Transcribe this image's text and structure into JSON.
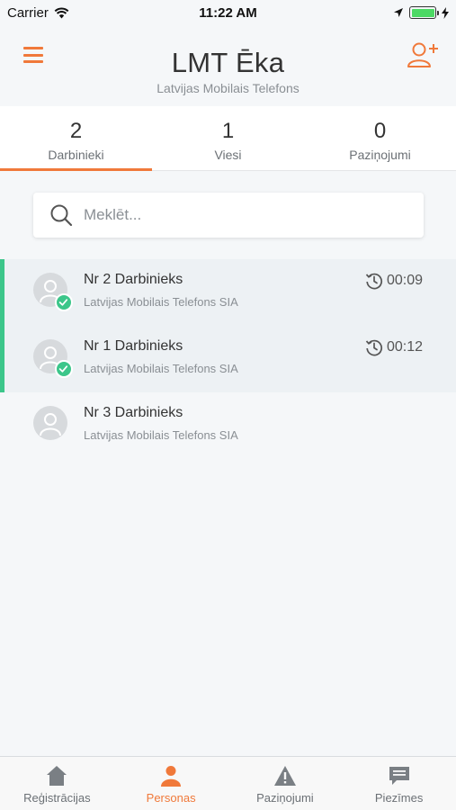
{
  "status_bar": {
    "carrier": "Carrier",
    "time": "11:22 AM",
    "battery_level": 1.0
  },
  "header": {
    "title": "LMT Ēka",
    "subtitle": "Latvijas Mobilais Telefons",
    "accent": "#f0793a"
  },
  "tabs": [
    {
      "count": "2",
      "label": "Darbinieki",
      "active": true
    },
    {
      "count": "1",
      "label": "Viesi",
      "active": false
    },
    {
      "count": "0",
      "label": "Paziņojumi",
      "active": false
    }
  ],
  "search": {
    "placeholder": "Meklēt...",
    "value": ""
  },
  "people": [
    {
      "name": "Nr 2 Darbinieks",
      "company": "Latvijas Mobilais Telefons SIA",
      "time": "00:09",
      "checked_in": true
    },
    {
      "name": "Nr 1 Darbinieks",
      "company": "Latvijas Mobilais Telefons SIA",
      "time": "00:12",
      "checked_in": true
    },
    {
      "name": "Nr 3 Darbinieks",
      "company": "Latvijas Mobilais Telefons SIA",
      "time": "",
      "checked_in": false
    }
  ],
  "bottom_nav": [
    {
      "label": "Reģistrācijas",
      "icon": "home-icon",
      "active": false
    },
    {
      "label": "Personas",
      "icon": "person-icon",
      "active": true
    },
    {
      "label": "Paziņojumi",
      "icon": "warning-icon",
      "active": false
    },
    {
      "label": "Piezīmes",
      "icon": "chat-icon",
      "active": false
    }
  ],
  "colors": {
    "accent": "#f0793a",
    "success": "#3cc68a"
  }
}
